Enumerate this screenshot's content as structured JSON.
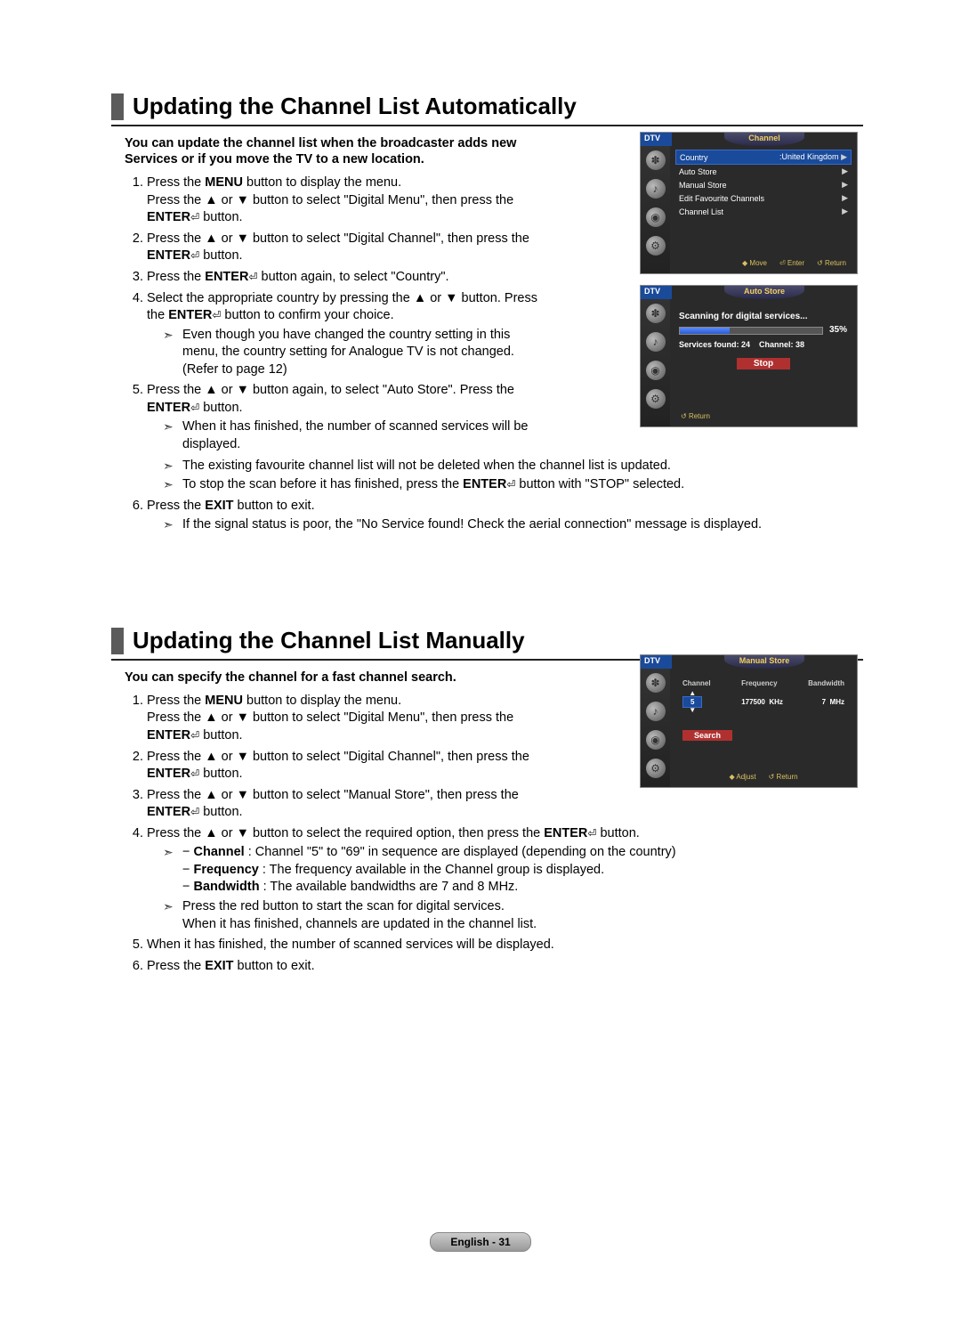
{
  "section1": {
    "heading": "Updating the Channel List Automatically",
    "intro": "You can update the channel list when the broadcaster adds new Services or if you move the TV to a new location.",
    "steps": {
      "s1a": "Press the ",
      "s1b": "MENU",
      "s1c": " button to display the menu.",
      "s1d": "Press the ▲ or ▼ button to select \"Digital Menu\", then press the ",
      "s1e": "ENTER",
      "s1f": " button.",
      "s2a": "Press the ▲ or ▼ button to select \"Digital Channel\", then press the ",
      "s2b": "ENTER",
      "s2c": " button.",
      "s3a": "Press the ",
      "s3b": "ENTER",
      "s3c": " button again, to select \"Country\".",
      "s4a": "Select the appropriate country by pressing the ▲ or ▼ button. Press the ",
      "s4b": "ENTER",
      "s4c": " button to confirm your choice.",
      "s4n": "Even though you have changed the country setting in this menu, the country setting for Analogue TV is not changed. (Refer to page 12)",
      "s5a": "Press the ▲ or ▼ button again, to select \"Auto Store\". Press the ",
      "s5b": "ENTER",
      "s5c": " button.",
      "s5n1": "When it has finished, the number of scanned services will be displayed.",
      "s5n2": "The existing favourite channel list will not be deleted when the channel list is updated.",
      "s5n3a": "To stop the scan before it has finished, press the ",
      "s5n3b": "ENTER",
      "s5n3c": " button with \"STOP\" selected.",
      "s6a": "Press the ",
      "s6b": "EXIT",
      "s6c": " button to exit.",
      "s6n": "If the signal status is poor, the \"No Service found! Check the aerial connection\" message is displayed."
    }
  },
  "section2": {
    "heading": "Updating the Channel List Manually",
    "intro": "You can specify the channel for a fast channel search.",
    "steps": {
      "s1a": "Press the ",
      "s1b": "MENU",
      "s1c": " button to display the menu.",
      "s1d": "Press the ▲ or ▼ button to select \"Digital Menu\", then press the ",
      "s1e": "ENTER",
      "s1f": " button.",
      "s2a": "Press the ▲ or ▼ button to select \"Digital Channel\", then press the ",
      "s2b": "ENTER",
      "s2c": " button.",
      "s3a": "Press the ▲ or ▼ button to select \"Manual Store\", then press the ",
      "s3b": "ENTER",
      "s3c": " button.",
      "s4a": "Press the ▲ or ▼ button to select the required option, then press the ",
      "s4b": "ENTER",
      "s4c": " button.",
      "s4n1a": "− ",
      "s4n1b": "Channel",
      "s4n1c": " : Channel \"5\" to \"69\" in sequence are displayed (depending on the country)",
      "s4n2a": "− ",
      "s4n2b": "Frequency",
      "s4n2c": " : The frequency available in the Channel group is displayed.",
      "s4n3a": "− ",
      "s4n3b": "Bandwidth",
      "s4n3c": " : The available bandwidths are 7 and 8 MHz.",
      "s4n4": "Press the red button to start the scan for digital services.",
      "s4n5": "When it has finished, channels are updated in the channel list.",
      "s5": "When it has finished, the number of scanned services will be displayed.",
      "s6a": "Press the ",
      "s6b": "EXIT",
      "s6c": " button to exit."
    }
  },
  "tv1": {
    "dtv": "DTV",
    "title": "Channel",
    "rows": {
      "r1a": "Country",
      "r1v": ":United Kingdom",
      "r2": "Auto Store",
      "r3": "Manual Store",
      "r4": "Edit Favourite Channels",
      "r5": "Channel List"
    },
    "footer": {
      "move": "Move",
      "enter": "Enter",
      "return": "Return"
    }
  },
  "tv2": {
    "dtv": "DTV",
    "title": "Auto Store",
    "scan": "Scanning for digital services...",
    "pct": "35%",
    "pctval": 35,
    "svc": "Services found: 24",
    "chn": "Channel: 38",
    "stop": "Stop",
    "return": "Return"
  },
  "tv3": {
    "dtv": "DTV",
    "title": "Manual Store",
    "col1": "Channel",
    "col2": "Frequency",
    "col3": "Bandwidth",
    "v1": "5",
    "v2": "177500",
    "v2u": "KHz",
    "v3": "7",
    "v3u": "MHz",
    "search": "Search",
    "adjust": "Adjust",
    "return": "Return"
  },
  "footer": "English - 31"
}
